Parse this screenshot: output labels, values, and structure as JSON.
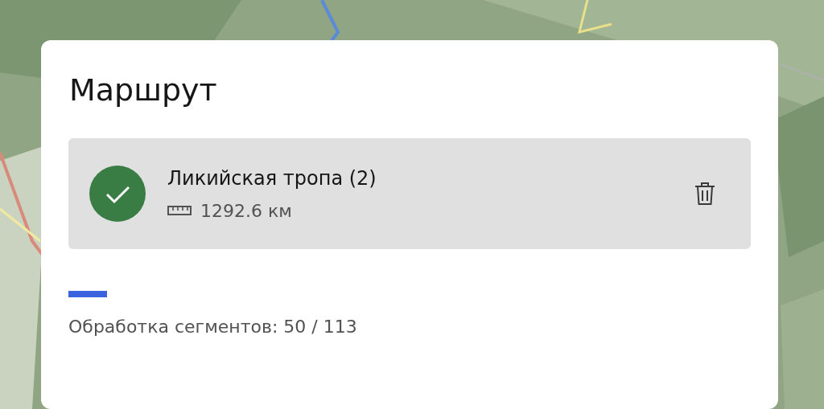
{
  "dialog": {
    "title": "Маршрут",
    "routes": [
      {
        "name": "Ликийская тропа (2)",
        "distance": "1292.6 км",
        "selected": true
      }
    ],
    "progress": {
      "level": 0.057,
      "label": "Обработка сегментов: 50 / 113"
    }
  }
}
